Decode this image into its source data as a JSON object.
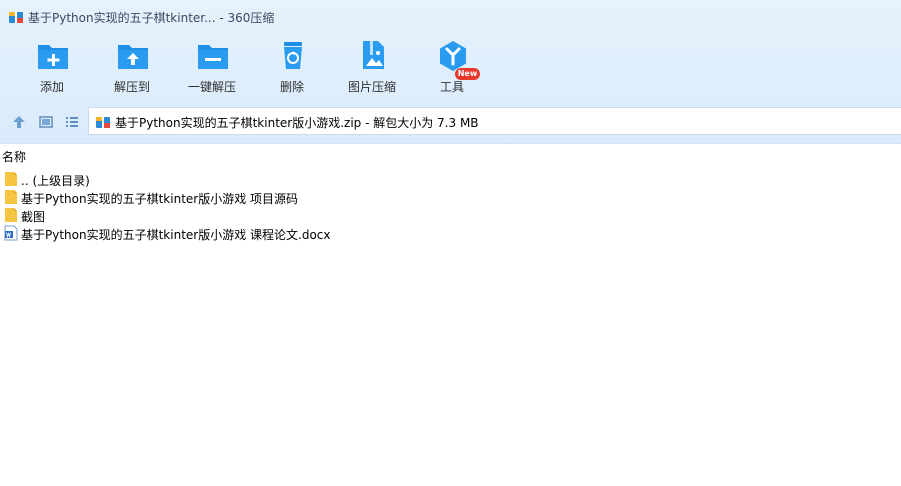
{
  "window": {
    "title": "基于Python实现的五子棋tkinter... - 360压缩"
  },
  "toolbar": {
    "items": [
      {
        "label": "添加",
        "icon": "add-icon"
      },
      {
        "label": "解压到",
        "icon": "extract-to-icon"
      },
      {
        "label": "一键解压",
        "icon": "one-click-extract-icon"
      },
      {
        "label": "删除",
        "icon": "delete-icon"
      },
      {
        "label": "图片压缩",
        "icon": "image-compress-icon"
      },
      {
        "label": "工具",
        "icon": "tools-icon",
        "badge": "New"
      }
    ]
  },
  "addressbar": {
    "text": "基于Python实现的五子棋tkinter版小游戏.zip - 解包大小为 7.3 MB"
  },
  "list": {
    "column_name": "名称",
    "rows": [
      {
        "name": ".. (上级目录)",
        "type": "parent"
      },
      {
        "name": "基于Python实现的五子棋tkinter版小游戏 项目源码",
        "type": "folder"
      },
      {
        "name": "截图",
        "type": "folder"
      },
      {
        "name": "基于Python实现的五子棋tkinter版小游戏 课程论文.docx",
        "type": "docx"
      }
    ]
  },
  "colors": {
    "accent": "#1e8fe6",
    "toolbar_bg": "#dfeefc",
    "folder": "#f5c542",
    "badge": "#e8372c"
  }
}
